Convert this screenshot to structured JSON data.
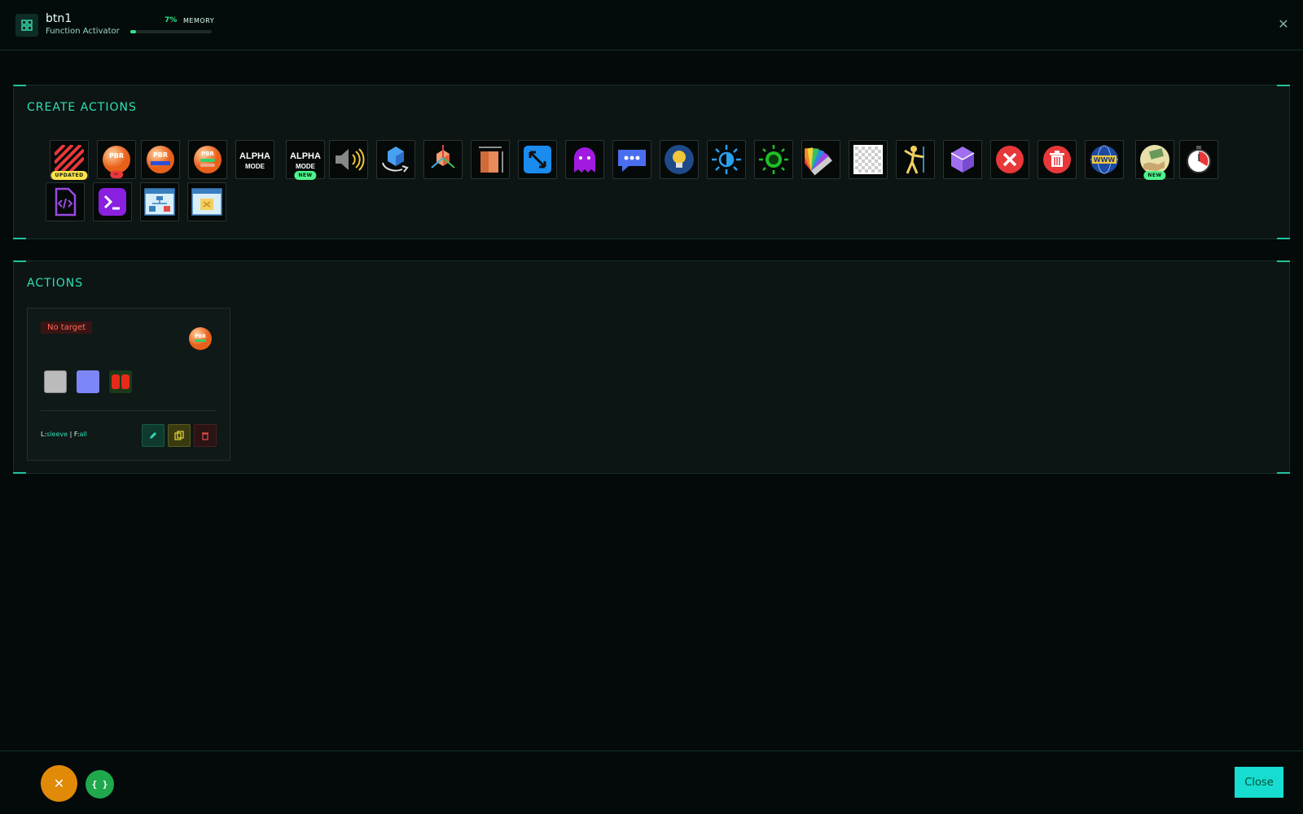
{
  "header": {
    "title": "btn1",
    "subtitle": "Function Activator",
    "memory_percent": "7%",
    "memory_label": "MEMORY",
    "memory_fraction": 0.07
  },
  "create_actions": {
    "title": "CREATE ACTIONS",
    "badges": {
      "updated": "UPDATED",
      "new": "NEW"
    },
    "alpha_text": {
      "line1": "ALPHA",
      "line2": "MODE"
    },
    "pbr_text": "PBR"
  },
  "actions": {
    "title": "ACTIONS",
    "card": {
      "status": "No target",
      "layer_label": "L:",
      "layer_value": "sleeve",
      "filter_label": "| F:",
      "filter_value": "all"
    }
  },
  "footer": {
    "close_label": "Close",
    "json_label": "{ }",
    "cancel_label": "✕"
  },
  "colors": {
    "accent": "#2ee0b8",
    "memory": "#35e38a",
    "close_btn": "#17dcd0"
  }
}
